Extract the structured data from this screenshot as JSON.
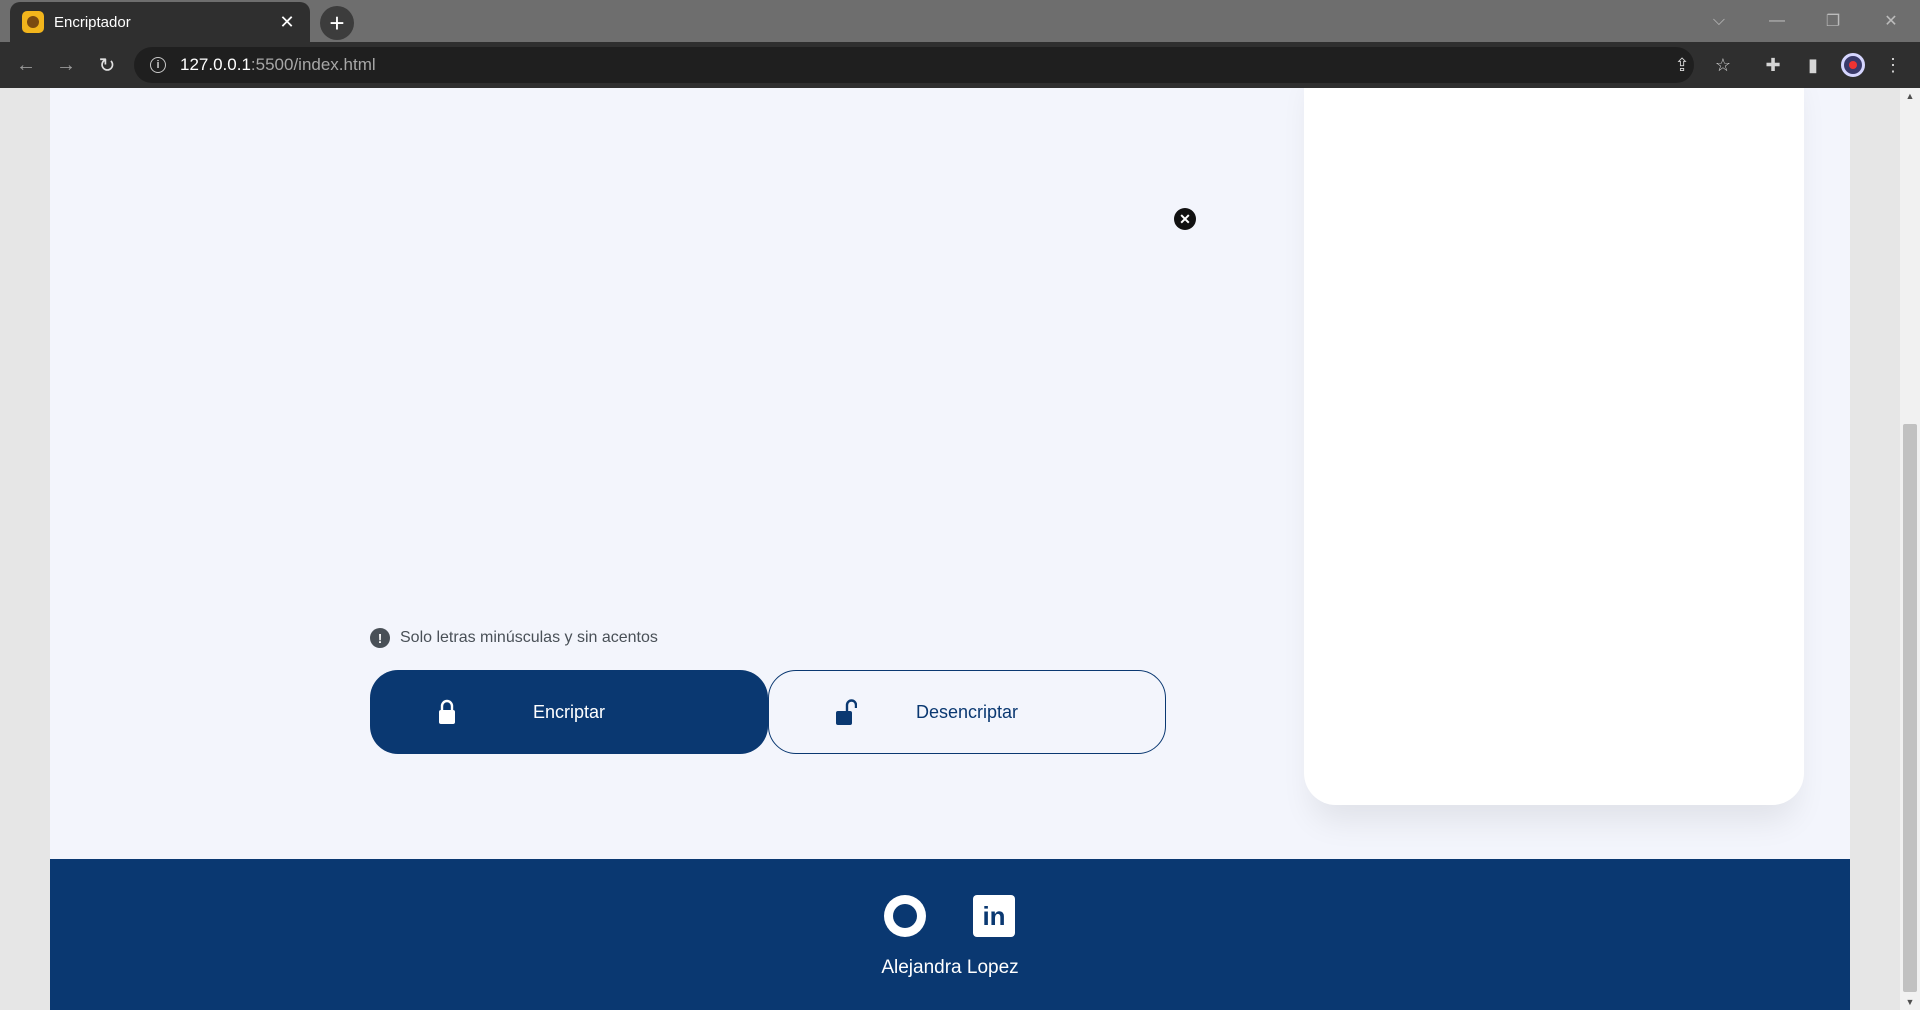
{
  "browser": {
    "tab_title": "Encriptador",
    "tab_close": "✕",
    "new_tab": "+",
    "url_host": "127.0.0.1",
    "url_path": ":5500/index.html",
    "nav": {
      "back": "←",
      "forward": "→",
      "reload": "↻"
    },
    "window": {
      "dropdown": "⌵",
      "minimize": "—",
      "restore": "❐",
      "close": "✕"
    },
    "omnibox_icons": {
      "share": "⇪",
      "bookmark": "☆",
      "extensions": "✚",
      "sidepanel": "▮",
      "menu": "⋮"
    }
  },
  "page": {
    "hint_text": "Solo letras minúsculas y sin acentos",
    "hint_icon": "!",
    "clear_icon": "✕",
    "encrypt_label": "Encriptar",
    "decrypt_label": "Desencriptar"
  },
  "footer": {
    "author": "Alejandra Lopez",
    "linkedin_text": "in"
  },
  "colors": {
    "accent": "#0a3871",
    "page_background": "#f3f5fc",
    "card_background": "#ffffff"
  }
}
